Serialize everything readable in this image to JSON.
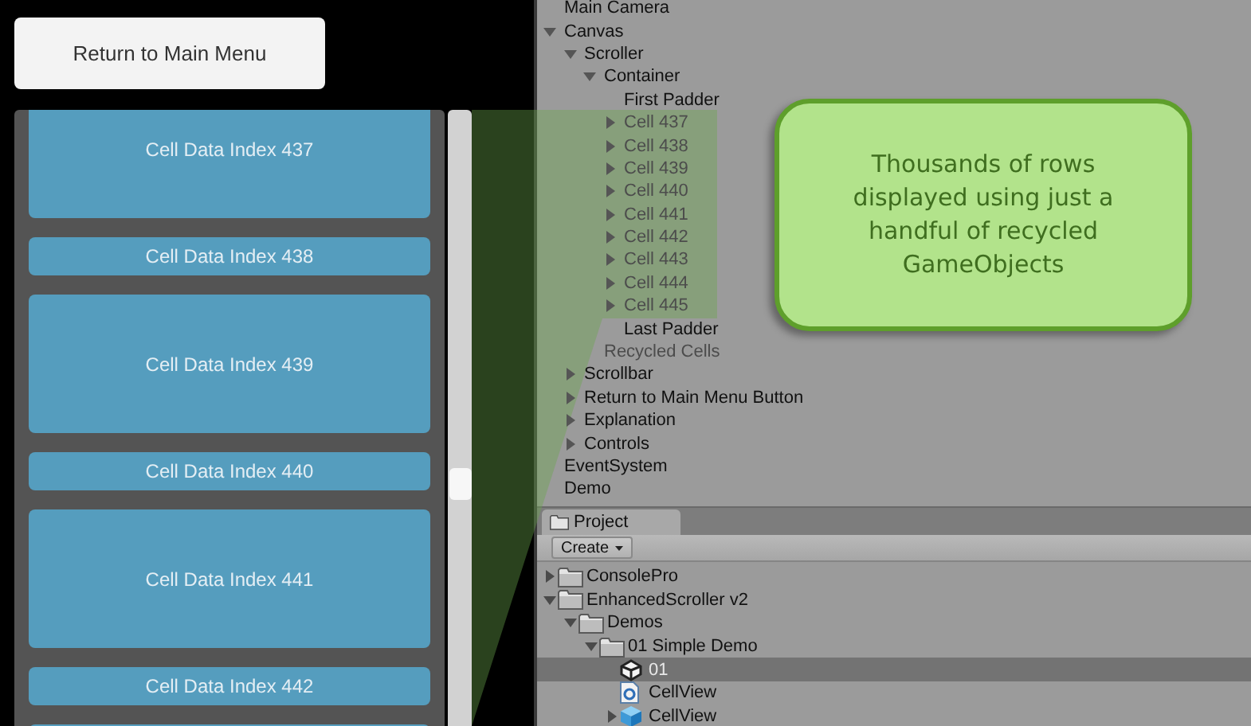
{
  "return_button": "Return to Main Menu",
  "cells": [
    {
      "label": "Cell Data Index 437",
      "kind": "large"
    },
    {
      "label": "Cell Data Index 438",
      "kind": "small"
    },
    {
      "label": "Cell Data Index 439",
      "kind": "large"
    },
    {
      "label": "Cell Data Index 440",
      "kind": "small"
    },
    {
      "label": "Cell Data Index 441",
      "kind": "large"
    },
    {
      "label": "Cell Data Index 442",
      "kind": "small"
    }
  ],
  "hierarchy": [
    {
      "name": "Main Camera",
      "dimmed": false
    },
    {
      "name": "Canvas",
      "dimmed": false,
      "expanded": true,
      "children": [
        {
          "name": "Scroller",
          "dimmed": false,
          "expanded": true,
          "children": [
            {
              "name": "Container",
              "dimmed": false,
              "expanded": true,
              "children": [
                {
                  "name": "First Padder",
                  "dimmed": false
                },
                {
                  "name": "Cell 437",
                  "dimmed": true,
                  "expanded": false
                },
                {
                  "name": "Cell 438",
                  "dimmed": true,
                  "expanded": false
                },
                {
                  "name": "Cell 439",
                  "dimmed": true,
                  "expanded": false
                },
                {
                  "name": "Cell 440",
                  "dimmed": true,
                  "expanded": false
                },
                {
                  "name": "Cell 441",
                  "dimmed": true,
                  "expanded": false
                },
                {
                  "name": "Cell 442",
                  "dimmed": true,
                  "expanded": false
                },
                {
                  "name": "Cell 443",
                  "dimmed": true,
                  "expanded": false
                },
                {
                  "name": "Cell 444",
                  "dimmed": true,
                  "expanded": false
                },
                {
                  "name": "Cell 445",
                  "dimmed": true,
                  "expanded": false
                },
                {
                  "name": "Last Padder",
                  "dimmed": false
                }
              ]
            },
            {
              "name": "Recycled Cells",
              "dimmed": true
            }
          ]
        },
        {
          "name": "Scrollbar",
          "dimmed": false,
          "expanded": false
        },
        {
          "name": "Return to Main Menu Button",
          "dimmed": false,
          "expanded": false
        },
        {
          "name": "Explanation",
          "dimmed": false,
          "expanded": false
        },
        {
          "name": "Controls",
          "dimmed": false,
          "expanded": false
        }
      ]
    },
    {
      "name": "EventSystem",
      "dimmed": false
    },
    {
      "name": "Demo",
      "dimmed": false
    }
  ],
  "callout": "Thousands of rows displayed using just a handful of recycled GameObjects",
  "project": {
    "tab": "Project",
    "create_button": "Create",
    "items": [
      {
        "name": "ConsolePro",
        "kind": "folder",
        "selected": false,
        "expanded": false
      },
      {
        "name": "EnhancedScroller v2",
        "kind": "folder",
        "selected": false,
        "expanded": true,
        "children": [
          {
            "name": "Demos",
            "kind": "folder",
            "selected": false,
            "expanded": true,
            "children": [
              {
                "name": "01 Simple Demo",
                "kind": "folder",
                "selected": false,
                "expanded": true,
                "children": [
                  {
                    "name": "01",
                    "kind": "scene",
                    "selected": true
                  },
                  {
                    "name": "CellView",
                    "kind": "script",
                    "selected": false
                  },
                  {
                    "name": "CellView",
                    "kind": "prefab",
                    "selected": false,
                    "expanded": false
                  }
                ]
              }
            ]
          }
        ]
      }
    ]
  }
}
